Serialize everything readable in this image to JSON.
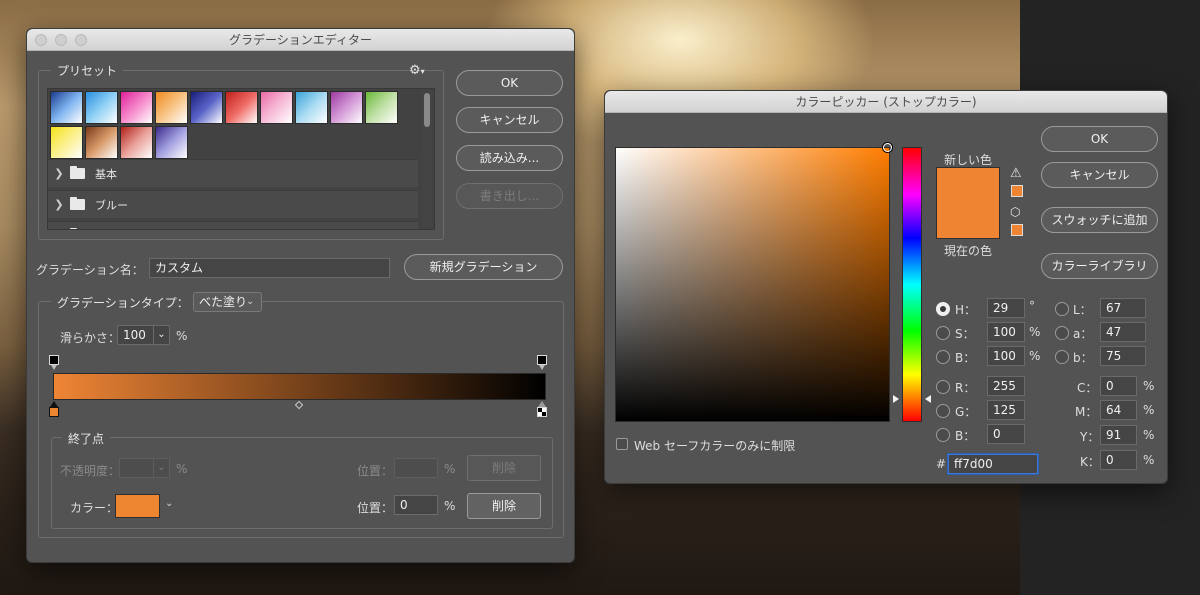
{
  "gradient_editor": {
    "title": "グラデーションエディター",
    "presets": {
      "title": "プリセット",
      "swatch_count": 14,
      "folders": [
        "基本",
        "ブルー"
      ]
    },
    "buttons": {
      "ok": "OK",
      "cancel": "キャンセル",
      "load": "読み込み...",
      "save": "書き出し...",
      "new_gradient": "新規グラデーション"
    },
    "name_label": "グラデーション名：",
    "name_value": "カスタム",
    "type_group": {
      "title": "グラデーションタイプ：",
      "type_value": "べた塗り",
      "smoothness_label": "滑らかさ：",
      "smoothness_value": "100",
      "smoothness_unit": "%"
    },
    "stops_group": {
      "title": "終了点",
      "opacity_label": "不透明度：",
      "opacity_unit": "%",
      "position_label": "位置：",
      "position_unit": "%",
      "delete_label": "削除",
      "color_label": "カラー：",
      "position_value": "0"
    },
    "colors": {
      "stop_color": "#ee8631",
      "gradient_start": "#ef8535",
      "gradient_end": "#000000"
    }
  },
  "color_picker": {
    "title": "カラーピッカー (ストップカラー)",
    "buttons": {
      "ok": "OK",
      "cancel": "キャンセル",
      "add_swatch": "スウォッチに追加",
      "color_library": "カラーライブラリ"
    },
    "new_color_label": "新しい色",
    "current_color_label": "現在の色",
    "new_color": "#ef8432",
    "current_color": "#ef8432",
    "hsb": [
      {
        "label": "H：",
        "value": "29",
        "unit": "°"
      },
      {
        "label": "S：",
        "value": "100",
        "unit": "%"
      },
      {
        "label": "B：",
        "value": "100",
        "unit": "%"
      }
    ],
    "rgb": [
      {
        "label": "R：",
        "value": "255"
      },
      {
        "label": "G：",
        "value": "125"
      },
      {
        "label": "B：",
        "value": "0"
      }
    ],
    "lab": [
      {
        "label": "L：",
        "value": "67"
      },
      {
        "label": "a：",
        "value": "47"
      },
      {
        "label": "b：",
        "value": "75"
      }
    ],
    "cmyk": [
      {
        "label": "C：",
        "value": "0",
        "unit": "%"
      },
      {
        "label": "M：",
        "value": "64",
        "unit": "%"
      },
      {
        "label": "Y：",
        "value": "91",
        "unit": "%"
      },
      {
        "label": "K：",
        "value": "0",
        "unit": "%"
      }
    ],
    "hex_label": "#",
    "hex_value": "ff7d00",
    "web_safe_label": "Web セーフカラーのみに制限",
    "hue_color": "#ff7d00"
  }
}
